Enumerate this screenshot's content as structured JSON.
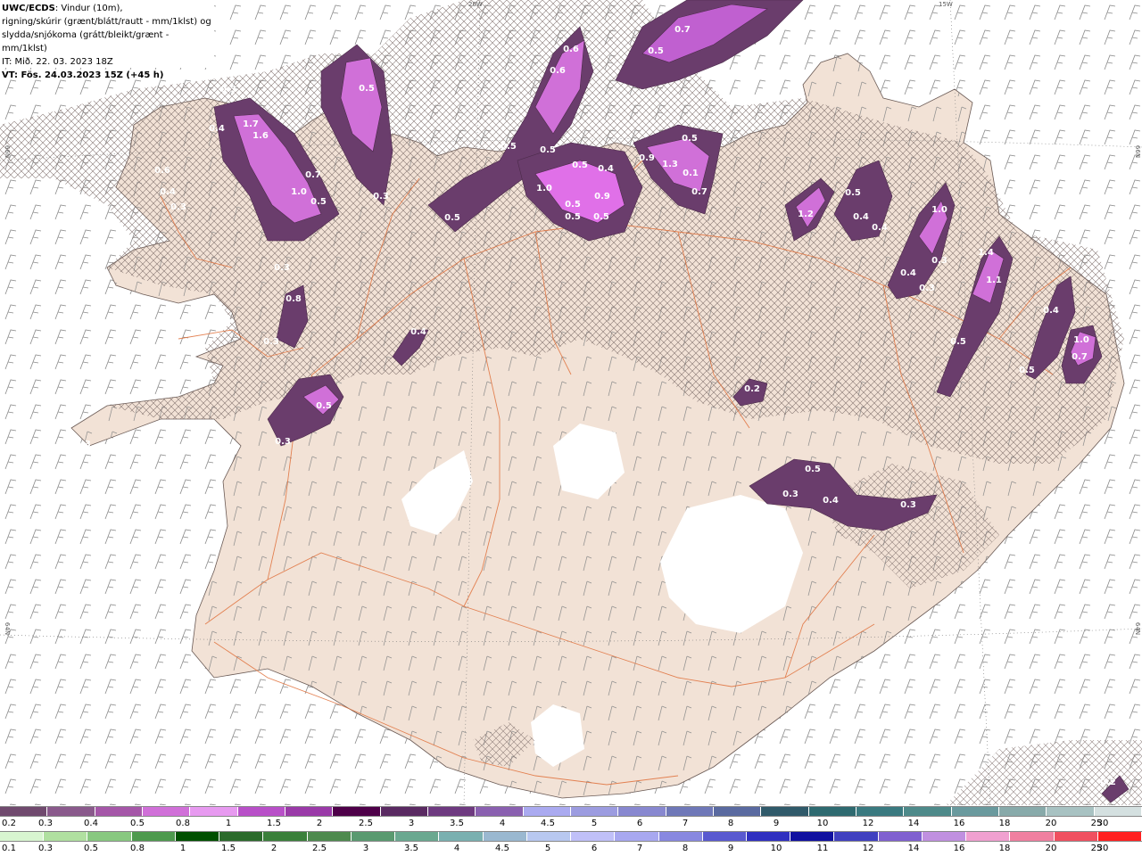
{
  "title": {
    "product": "UWC/ECDS",
    "line1_rest": ": Vindur (10m),",
    "line2": "rigning/skúrir (grænt/blátt/rautt - mm/1klst) og",
    "line3": "slydda/snjókoma (grátt/bleikt/grænt - mm/1klst)",
    "line4": "IT: Mið. 22. 03. 2023 18Z",
    "line5": "VT: Fös. 24.03.2023 15Z (+45 h)"
  },
  "graticule": {
    "top_20w": "20W",
    "top_15w": "15W",
    "left_66n": "66N",
    "right_66n": "66N",
    "left_64n": "64N",
    "right_64n": "64N"
  },
  "precip_labels": [
    "0.3",
    "0.4",
    "0.6",
    "0.4",
    "0.3",
    "1.7",
    "1.6",
    "0.5",
    "1.0",
    "0.7",
    "0.5",
    "0.3",
    "0.6",
    "0.6",
    "0.5",
    "0.5",
    "0.9",
    "1.3",
    "0.5",
    "0.1",
    "0.7",
    "0.7",
    "0.5",
    "0.5",
    "0.4",
    "1.0",
    "0.5",
    "0.5",
    "0.9",
    "0.5",
    "0.5",
    "1.2",
    "0.5",
    "0.4",
    "0.4",
    "1.0",
    "0.4",
    "0.3",
    "1.4",
    "1.1",
    "0.3",
    "0.4",
    "0.5",
    "0.5",
    "1.0",
    "0.7",
    "0.3",
    "0.4",
    "0.3",
    "0.8",
    "0.3",
    "0.5",
    "0.3",
    "0.2",
    "0.5",
    "0.3",
    "0.4",
    "0.3",
    "0.2"
  ],
  "legend": {
    "snow_scale": {
      "colors": [
        "#704a6e",
        "#8a5a8c",
        "#a557a8",
        "#d070d8",
        "#e79af0",
        "#b850c8",
        "#9a3aa8",
        "#4e0049",
        "#5a2a62",
        "#6e3a80",
        "#8a60b0",
        "#aaaaf0",
        "#9c9ce0",
        "#8888d0",
        "#6f78b8",
        "#5a6aa0",
        "#305a6a",
        "#2e6a70",
        "#3a7a80",
        "#4e8a8a",
        "#6a9a9e",
        "#88aaaa",
        "#a8c2c2",
        "#d4e0e0"
      ],
      "labels": [
        "0.2",
        "0.3",
        "0.4",
        "0.5",
        "0.8",
        "1",
        "1.5",
        "2",
        "2.5",
        "3",
        "3.5",
        "4",
        "4.5",
        "5",
        "6",
        "7",
        "8",
        "9",
        "10",
        "12",
        "14",
        "16",
        "18",
        "20",
        "25",
        "30"
      ]
    },
    "rain_scale": {
      "colors": [
        "#d8f5d0",
        "#b0e0a0",
        "#88c880",
        "#4e9a4e",
        "#005000",
        "#2a6a2a",
        "#3a803a",
        "#4e8a4e",
        "#5a9a70",
        "#6aa890",
        "#7ab0b0",
        "#9ab8d0",
        "#b8c8f0",
        "#c0c0f8",
        "#a8a8f0",
        "#8888e0",
        "#5a5ad0",
        "#3030c0",
        "#1010a0",
        "#4040c0",
        "#8060d0",
        "#c090e0",
        "#f0a0d0",
        "#f080a0",
        "#f05060",
        "#ff2020"
      ],
      "labels": [
        "0.1",
        "0.3",
        "0.5",
        "0.8",
        "1",
        "1.5",
        "2",
        "2.5",
        "3",
        "3.5",
        "4",
        "4.5",
        "5",
        "6",
        "7",
        "8",
        "9",
        "10",
        "11",
        "12",
        "14",
        "16",
        "18",
        "20",
        "25",
        "30"
      ]
    }
  }
}
